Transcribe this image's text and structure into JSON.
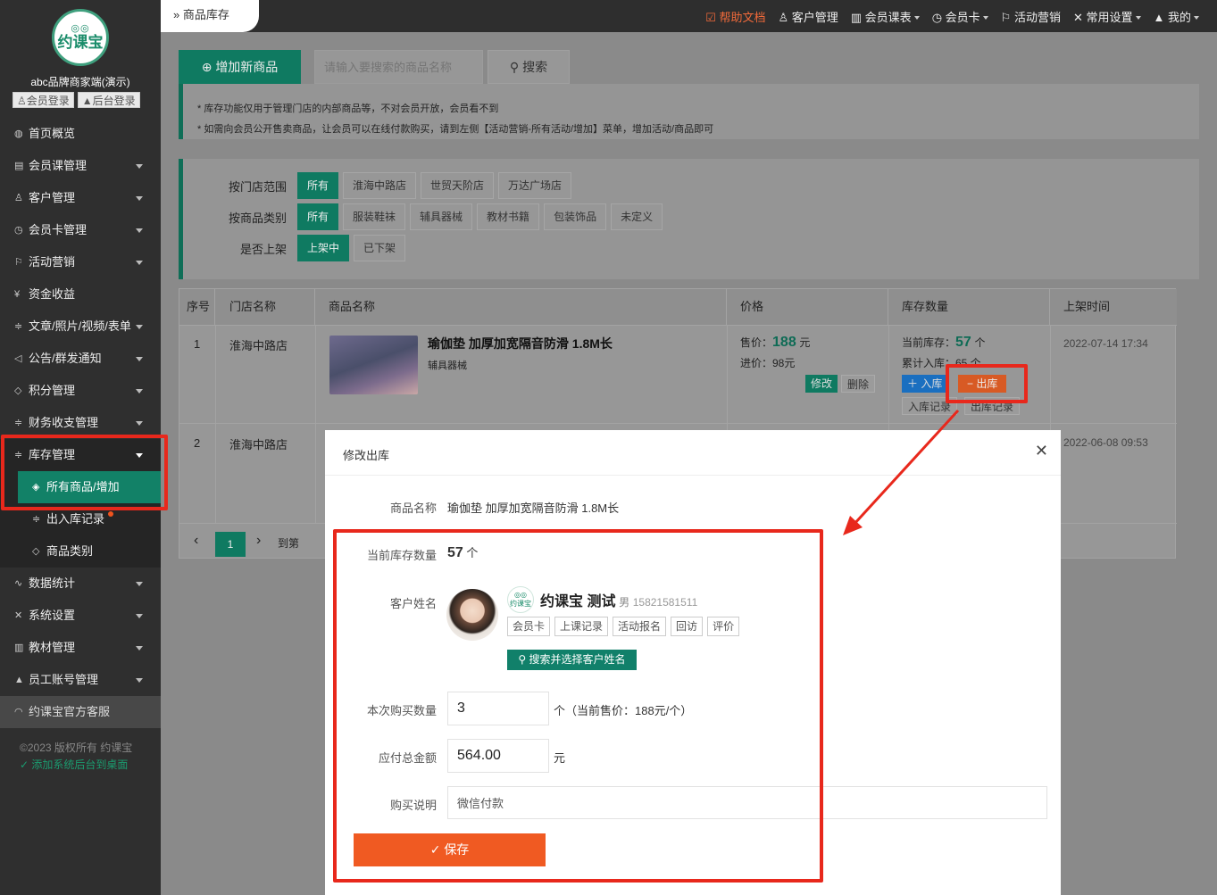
{
  "sidebar": {
    "logo_text": "约课宝",
    "brand": "abc品牌商家端(演示)",
    "login_member": "会员登录",
    "login_admin": "后台登录",
    "items": [
      {
        "label": "首页概览",
        "icon": "globe-icon",
        "arrow": false
      },
      {
        "label": "会员课管理",
        "icon": "doc-icon",
        "arrow": true
      },
      {
        "label": "客户管理",
        "icon": "user-icon",
        "arrow": true
      },
      {
        "label": "会员卡管理",
        "icon": "clock-icon",
        "arrow": true
      },
      {
        "label": "活动营销",
        "icon": "flag-icon",
        "arrow": true
      },
      {
        "label": "资金收益",
        "icon": "yen-icon",
        "arrow": false
      },
      {
        "label": "文章/照片/视频/表单",
        "icon": "sliders-icon",
        "arrow": true
      },
      {
        "label": "公告/群发通知",
        "icon": "speaker-icon",
        "arrow": true
      },
      {
        "label": "积分管理",
        "icon": "diamond-icon",
        "arrow": true
      },
      {
        "label": "财务收支管理",
        "icon": "sliders-icon",
        "arrow": true
      }
    ],
    "inventory": {
      "label": "库存管理",
      "sub": [
        "所有商品/增加",
        "出入库记录",
        "商品类别"
      ]
    },
    "items2": [
      {
        "label": "数据统计",
        "icon": "pulse-icon"
      },
      {
        "label": "系统设置",
        "icon": "tools-icon"
      },
      {
        "label": "教材管理",
        "icon": "book-icon"
      },
      {
        "label": "员工账号管理",
        "icon": "person-icon"
      }
    ],
    "service": "约课宝官方客服",
    "copyright": "©2023 版权所有 约课宝",
    "add_desktop": "添加系统后台到桌面"
  },
  "topbar": {
    "breadcrumb": "商品库存",
    "links": [
      "帮助文档",
      "客户管理",
      "会员课表",
      "会员卡",
      "活动营销",
      "常用设置",
      "我的"
    ]
  },
  "toolbar": {
    "add_label": "增加新商品",
    "search_placeholder": "请输入要搜索的商品名称",
    "search_label": "搜索"
  },
  "notice": {
    "line1": "* 库存功能仅用于管理门店的内部商品等，不对会员开放，会员看不到",
    "line2": "* 如需向会员公开售卖商品，让会员可以在线付款购买，请到左侧【活动营销-所有活动/增加】菜单，增加活动/商品即可"
  },
  "filters": {
    "store": {
      "label": "按门店范围",
      "options": [
        "所有",
        "淮海中路店",
        "世贸天阶店",
        "万达广场店"
      ],
      "selected": 0
    },
    "category": {
      "label": "按商品类别",
      "options": [
        "所有",
        "服装鞋袜",
        "辅具器械",
        "教材书籍",
        "包装饰品",
        "未定义"
      ],
      "selected": 0
    },
    "shelf": {
      "label": "是否上架",
      "options": [
        "上架中",
        "已下架"
      ],
      "selected": 0
    }
  },
  "table": {
    "headers": [
      "序号",
      "门店名称",
      "商品名称",
      "价格",
      "库存数量",
      "上架时间"
    ],
    "rows": [
      {
        "no": "1",
        "store": "淮海中路店",
        "name": "瑜伽垫 加厚加宽隔音防滑 1.8M长",
        "category": "辅具器械",
        "sale_label": "售价：",
        "sale_price": "188",
        "sale_unit": "元",
        "cost": "进价：98元",
        "edit": "修改",
        "delete": "删除",
        "stock_label": "当前库存：",
        "stock": "57",
        "stock_unit": "个",
        "total_in": "累计入库：65 个",
        "in_btn": "入库",
        "out_btn": "出库",
        "in_record": "入库记录",
        "out_record": "出库记录",
        "time": "2022-07-14 17:34"
      },
      {
        "no": "2",
        "store": "淮海中路店",
        "time": "2022-06-08 09:53"
      }
    ],
    "pager": {
      "current": "1",
      "goto": "到第"
    }
  },
  "modal": {
    "title": "修改出库",
    "name_label": "商品名称",
    "name_value": "瑜伽垫 加厚加宽隔音防滑 1.8M长",
    "stock_label": "当前库存数量",
    "stock_value": "57",
    "stock_unit": "个",
    "customer_label": "客户姓名",
    "customer_name": "约课宝 测试",
    "customer_gender": "男",
    "customer_phone": "15821581511",
    "tags": [
      "会员卡",
      "上课记录",
      "活动报名",
      "回访",
      "评价"
    ],
    "pick_label": "搜索并选择客户姓名",
    "qty_label": "本次购买数量",
    "qty_value": "3",
    "qty_note": "个（当前售价：188元/个）",
    "total_label": "应付总金额",
    "total_value": "564.00",
    "total_unit": "元",
    "remark_label": "购买说明",
    "remark_value": "微信付款",
    "save_label": "保存"
  },
  "colors": {
    "accent": "#0f7a61",
    "save": "#f05a22",
    "highlight": "#e8281c",
    "help": "#f26a3a"
  }
}
